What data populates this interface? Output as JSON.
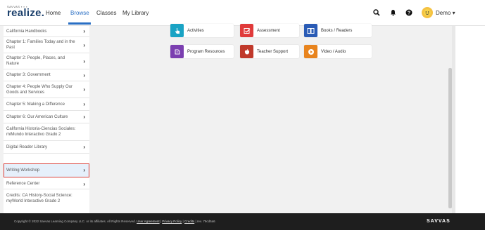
{
  "brand": {
    "logo_top": "SAVVAS ▪ ▪ ▪",
    "logo_main": "realize."
  },
  "nav": {
    "home": "Home",
    "browse": "Browse",
    "classes": "Classes",
    "library": "My Library"
  },
  "user": {
    "name": "Demo ▾"
  },
  "sidebar": {
    "items": [
      {
        "label": "California Handbooks"
      },
      {
        "label": "Chapter 1: Families Today and in the Past"
      },
      {
        "label": "Chapter 2: People, Places, and Nature"
      },
      {
        "label": "Chapter 3: Government"
      },
      {
        "label": "Chapter 4: People Who Supply Our Goods and Services"
      },
      {
        "label": "Chapter 5: Making a Difference"
      },
      {
        "label": "Chapter 6: Our American Culture"
      },
      {
        "label": "California Historia-Ciencias Sociales: miMundo Interactivo Grado 2"
      },
      {
        "label": "Digital Reader Library"
      },
      {
        "label": "Writing Workshop"
      },
      {
        "label": "Reference Center"
      },
      {
        "label": "Credits: CA History-Social Science: myWorld Interactive Grade 2"
      }
    ],
    "selected_index": 9
  },
  "tiles": [
    {
      "label": "Activities",
      "color": "#1aa3c4",
      "icon": "hand-pointer-icon"
    },
    {
      "label": "Assessment",
      "color": "#e03a3a",
      "icon": "checkbox-icon"
    },
    {
      "label": "Books / Readers",
      "color": "#2a5bb5",
      "icon": "book-icon"
    },
    {
      "label": "Program Resources",
      "color": "#7b3fb0",
      "icon": "folder-stack-icon"
    },
    {
      "label": "Teacher Support",
      "color": "#c0392b",
      "icon": "apple-icon"
    },
    {
      "label": "Video / Audio",
      "color": "#e8841e",
      "icon": "play-icon"
    }
  ],
  "footer": {
    "copyright": "Copyright © 2022 Savvas Learning Company LLC. or its affiliates. All Rights Reserved.",
    "user_agreement": "User Agreement",
    "privacy": "Privacy Policy",
    "credits": "Credits",
    "rev": "rev. 79cd5a6",
    "brand": "SAVVAS"
  }
}
